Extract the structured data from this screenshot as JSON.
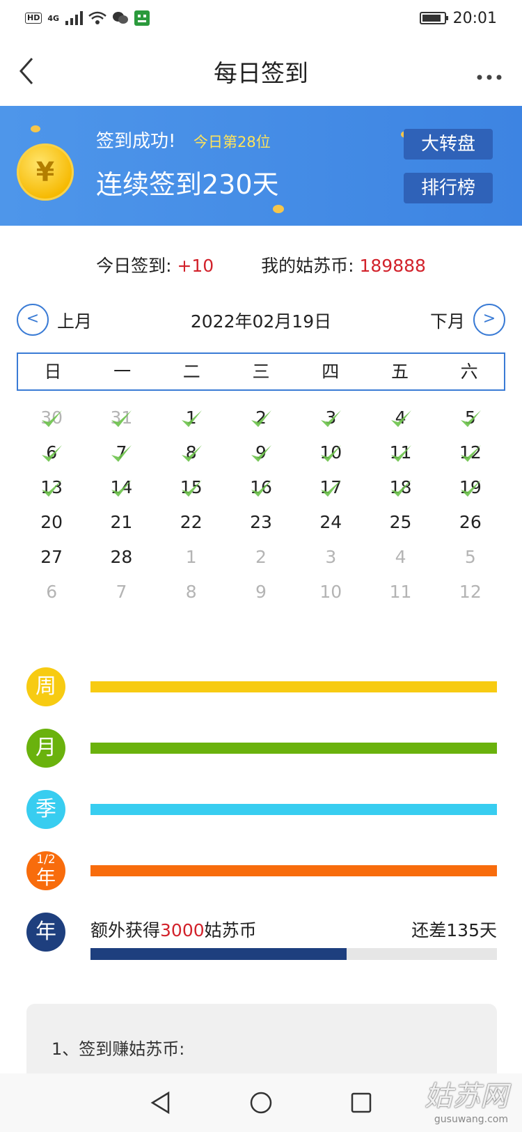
{
  "status_bar": {
    "left_badge": "HD",
    "network": "4G",
    "time": "20:01"
  },
  "nav": {
    "title": "每日签到",
    "back_icon": "back-chevron-icon",
    "more_icon": "more-dots-icon"
  },
  "banner": {
    "success": "签到成功!",
    "rank": "今日第28位",
    "streak": "连续签到230天",
    "wheel_button": "大转盘",
    "ranking_button": "排行榜",
    "coin_symbol": "¥"
  },
  "summary": {
    "today_label": "今日签到: ",
    "today_value": "+10",
    "coins_label": "我的姑苏币: ",
    "coins_value": "189888"
  },
  "month_nav": {
    "prev_label": "上月",
    "prev_arrow": "<",
    "date": "2022年02月19日",
    "next_label": "下月",
    "next_arrow": ">"
  },
  "weekdays": [
    "日",
    "一",
    "二",
    "三",
    "四",
    "五",
    "六"
  ],
  "calendar": [
    [
      {
        "d": "30",
        "muted": true,
        "checked": true
      },
      {
        "d": "31",
        "muted": true,
        "checked": true
      },
      {
        "d": "1",
        "checked": true
      },
      {
        "d": "2",
        "checked": true
      },
      {
        "d": "3",
        "checked": true
      },
      {
        "d": "4",
        "checked": true
      },
      {
        "d": "5",
        "checked": true
      }
    ],
    [
      {
        "d": "6",
        "checked": true
      },
      {
        "d": "7",
        "checked": true
      },
      {
        "d": "8",
        "checked": true
      },
      {
        "d": "9",
        "checked": true
      },
      {
        "d": "10",
        "checked": true
      },
      {
        "d": "11",
        "checked": true
      },
      {
        "d": "12",
        "checked": true
      }
    ],
    [
      {
        "d": "13",
        "checked": true
      },
      {
        "d": "14",
        "checked": true
      },
      {
        "d": "15",
        "checked": true
      },
      {
        "d": "16",
        "checked": true
      },
      {
        "d": "17",
        "checked": true
      },
      {
        "d": "18",
        "checked": true
      },
      {
        "d": "19",
        "checked": true
      }
    ],
    [
      {
        "d": "20"
      },
      {
        "d": "21"
      },
      {
        "d": "22"
      },
      {
        "d": "23"
      },
      {
        "d": "24"
      },
      {
        "d": "25"
      },
      {
        "d": "26"
      }
    ],
    [
      {
        "d": "27"
      },
      {
        "d": "28"
      },
      {
        "d": "1",
        "muted": true
      },
      {
        "d": "2",
        "muted": true
      },
      {
        "d": "3",
        "muted": true
      },
      {
        "d": "4",
        "muted": true
      },
      {
        "d": "5",
        "muted": true
      }
    ],
    [
      {
        "d": "6",
        "muted": true
      },
      {
        "d": "7",
        "muted": true
      },
      {
        "d": "8",
        "muted": true
      },
      {
        "d": "9",
        "muted": true
      },
      {
        "d": "10",
        "muted": true
      },
      {
        "d": "11",
        "muted": true
      },
      {
        "d": "12",
        "muted": true
      }
    ]
  ],
  "goals": {
    "week": {
      "label": "周",
      "color": "#f7cb12",
      "progress": 1.0
    },
    "month": {
      "label": "月",
      "color": "#6ab20d",
      "progress": 1.0
    },
    "quarter": {
      "label": "季",
      "color": "#38cdf0",
      "progress": 1.0
    },
    "half_year": {
      "label_top": "1/2",
      "label_bottom": "年",
      "color": "#f86c0c",
      "progress": 1.0
    },
    "year": {
      "label": "年",
      "color": "#1e3f7e",
      "progress": 0.63,
      "text_pre": "额外获得",
      "text_amount": "3000",
      "text_post": "姑苏币",
      "remaining": "还差135天"
    }
  },
  "rules": {
    "item1": "1、签到赚姑苏币:"
  },
  "watermark": {
    "big": "姑苏网",
    "small": "gusuwang.com"
  }
}
